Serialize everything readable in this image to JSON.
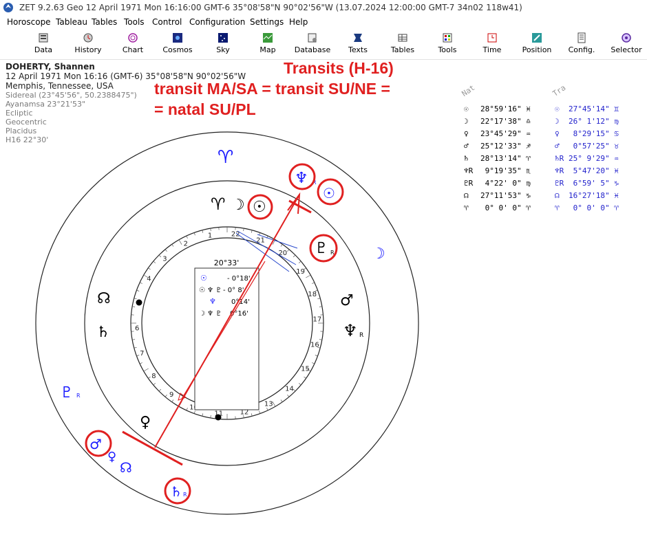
{
  "titlebar": {
    "title": "ZET 9.2.63 Geo    12 April 1971  Mon  16:16:00 GMT-6 35°08'58\"N  90°02'56\"W  (13.07.2024  12:00:00 GMT-7 34n02 118w41)"
  },
  "menu": [
    "Horoscope",
    "Tableau",
    "Tables",
    "Tools",
    "Control",
    "Configuration",
    "Settings",
    "Help"
  ],
  "toolbar": [
    {
      "label": "Data",
      "icon": "data-icon"
    },
    {
      "label": "History",
      "icon": "history-icon"
    },
    {
      "label": "Chart",
      "icon": "chart-icon"
    },
    {
      "label": "Cosmos",
      "icon": "cosmos-icon"
    },
    {
      "label": "Sky",
      "icon": "sky-icon"
    },
    {
      "label": "Map",
      "icon": "map-icon"
    },
    {
      "label": "Database",
      "icon": "database-icon"
    },
    {
      "label": "Texts",
      "icon": "texts-icon"
    },
    {
      "label": "Tables",
      "icon": "tables-icon"
    },
    {
      "label": "Tools",
      "icon": "tools-icon"
    },
    {
      "label": "Time",
      "icon": "time-icon"
    },
    {
      "label": "Position",
      "icon": "position-icon"
    },
    {
      "label": "Config.",
      "icon": "config-icon"
    },
    {
      "label": "Selector",
      "icon": "selector-icon"
    }
  ],
  "person": {
    "name": "DOHERTY, Shannen",
    "datetime": "12 April 1971  Mon  16:16 (GMT-6) 35°08'58\"N  90°02'56\"W",
    "place": "Memphis, Tennessee, USA",
    "settings": [
      "Sidereal (23°45'56\", 50.2388475\")",
      "Ayanamsa 23°21'53\"",
      "Ecliptic",
      "Geocentric",
      "Placidus",
      "H16  22°30'"
    ]
  },
  "annotations": {
    "line1": "Transits (H-16)",
    "line2": "transit MA/SA = transit SU/NE =",
    "line3": "= natal SU/PL"
  },
  "table": {
    "head_nat": "Nat",
    "head_tra": "Tra",
    "rows": [
      {
        "nat_sym": "☉",
        "nat": "28°59'16\" ♓",
        "tra_sym": "☉",
        "tra": "27°45'14\" ♊"
      },
      {
        "nat_sym": "☽",
        "nat": "22°17'38\" ♎",
        "tra_sym": "☽",
        "tra": "26° 1'12\" ♍"
      },
      {
        "nat_sym": "♀",
        "nat": "23°45'29\" ♒",
        "tra_sym": "♀",
        "tra": " 8°29'15\" ♋"
      },
      {
        "nat_sym": "♂",
        "nat": "25°12'33\" ♐",
        "tra_sym": "♂",
        "tra": " 0°57'25\" ♉"
      },
      {
        "nat_sym": "♄",
        "nat": "28°13'14\" ♈",
        "tra_sym": "♄R",
        "tra": "25° 9'29\" ♒"
      },
      {
        "nat_sym": "♆R",
        "nat": " 9°19'35\" ♏",
        "tra_sym": "♆R",
        "tra": " 5°47'20\" ♓"
      },
      {
        "nat_sym": "♇R",
        "nat": " 4°22' 0\" ♍",
        "tra_sym": "♇R",
        "tra": " 6°59' 5\" ♑"
      },
      {
        "nat_sym": "☊",
        "nat": "27°11'53\" ♑",
        "tra_sym": "☊",
        "tra": "16°27'18\" ♓"
      },
      {
        "nat_sym": "♈",
        "nat": " 0° 0' 0\" ♈",
        "tra_sym": "♈",
        "tra": " 0° 0' 0\" ♈"
      }
    ]
  },
  "chart": {
    "center_box": {
      "header": "20°33'",
      "lines": [
        {
          "sym": "☉",
          "text": "- 0°18'"
        },
        {
          "sym": "☉ ♆ ♇",
          "text": "- 0° 8'"
        },
        {
          "sym": "♆",
          "text": "0°14'"
        },
        {
          "sym": "☽ ♆ ♇",
          "text": "0°16'"
        }
      ]
    },
    "house_numbers": [
      "1",
      "2",
      "3",
      "4",
      "5",
      "6",
      "7",
      "8",
      "9",
      "10",
      "11",
      "12",
      "13",
      "14",
      "15",
      "16",
      "17",
      "18",
      "19",
      "20",
      "21",
      "22"
    ],
    "outer_glyphs": [
      {
        "sym": "♈",
        "color": "#1a1aff"
      },
      {
        "sym": "♆",
        "sub": "R",
        "color": "#1a1aff"
      },
      {
        "sym": "☉",
        "color": "#1a1aff"
      },
      {
        "sym": "☽",
        "color": "#1a1aff"
      },
      {
        "sym": "♇",
        "sub": "R",
        "color": "#1a1aff"
      },
      {
        "sym": "♂",
        "color": "#1a1aff"
      },
      {
        "sym": "♀",
        "color": "#1a1aff"
      },
      {
        "sym": "☊",
        "color": "#1a1aff"
      },
      {
        "sym": "♄",
        "sub": "R",
        "color": "#1a1aff"
      }
    ],
    "inner_glyphs": [
      {
        "sym": "♈",
        "color": "#000"
      },
      {
        "sym": "☽",
        "color": "#000"
      },
      {
        "sym": "☉",
        "color": "#000"
      },
      {
        "sym": "♇",
        "sub": "R",
        "color": "#000"
      },
      {
        "sym": "♂",
        "color": "#000"
      },
      {
        "sym": "♆",
        "sub": "R",
        "color": "#000"
      },
      {
        "sym": "☊",
        "color": "#000"
      },
      {
        "sym": "♄",
        "color": "#000"
      },
      {
        "sym": "♀",
        "color": "#000"
      }
    ]
  },
  "colors": {
    "accent_red": "#e02020",
    "transit_blue": "#1a1aff"
  }
}
